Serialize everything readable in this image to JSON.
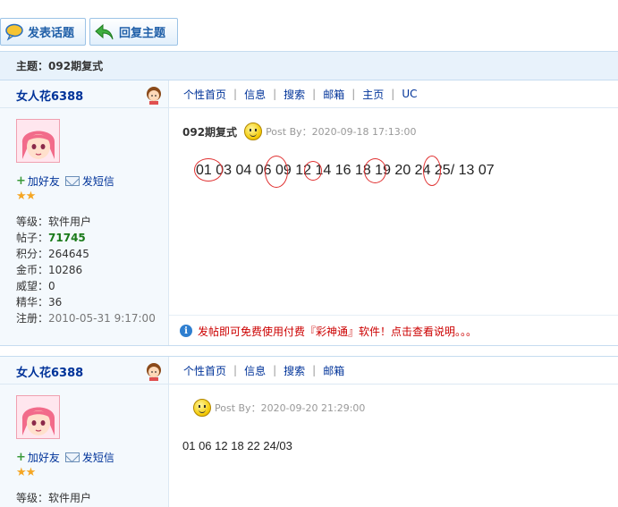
{
  "toolbar": {
    "post_label": "发表话题",
    "reply_label": "回复主题"
  },
  "topic": {
    "prefix": "主题：",
    "title": "092期复式"
  },
  "posts": [
    {
      "username": "女人花6388",
      "actions": {
        "add_friend": "加好友",
        "send_message": "发短信"
      },
      "stars": "★★",
      "stats": {
        "level_label": "等级：",
        "level": "软件用户",
        "posts_label": "帖子：",
        "posts": "71745",
        "points_label": "积分：",
        "points": "264645",
        "gold_label": "金币：",
        "gold": "10286",
        "prestige_label": "威望：",
        "prestige": "0",
        "elite_label": "精华：",
        "elite": "36",
        "register_label": "注册：",
        "register": "2010-05-31 9:17:00"
      },
      "nav": [
        "个性首页",
        "信息",
        "搜索",
        "邮箱",
        "主页",
        "UC"
      ],
      "title": "092期复式",
      "post_by": "Post By：2020-09-18 17:13:00",
      "numbers": "01 03 04 06 09 12 14 16 18 19 20 24 25/ 13   07",
      "notice": "发帖即可免费使用付费『彩神通』软件！点击查看说明。。。"
    },
    {
      "username": "女人花6388",
      "actions": {
        "add_friend": "加好友",
        "send_message": "发短信"
      },
      "stars": "★★",
      "stats": {
        "level_label": "等级：",
        "level": "软件用户"
      },
      "nav": [
        "个性首页",
        "信息",
        "搜索",
        "邮箱"
      ],
      "post_by": "Post By：2020-09-20 21:29:00",
      "numbers": "01 06 12 18 22 24/03"
    }
  ],
  "icons": {
    "post": "speech-bubble-icon",
    "reply": "reply-arrow-icon",
    "girl": "girl-icon",
    "smiley": "smiley-icon",
    "info": "info-icon"
  },
  "colors": {
    "link": "#003399",
    "notice": "#cc0000",
    "highlight_circle": "#e03030",
    "topic_bar": "#e8f2fb"
  }
}
